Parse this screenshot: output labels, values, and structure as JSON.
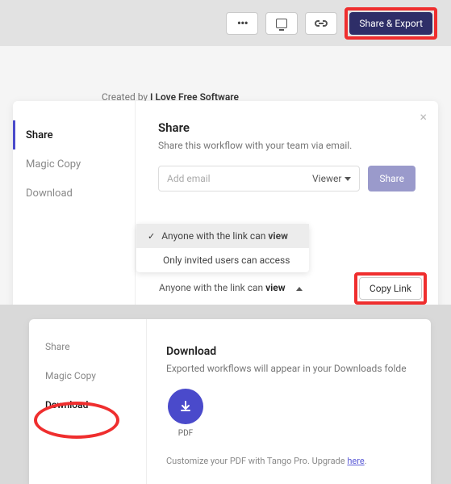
{
  "topbar": {
    "share_export_label": "Share & Export"
  },
  "created_by": {
    "prefix": "Created by ",
    "author": "I Love Free Software"
  },
  "share_panel": {
    "sidebar": [
      {
        "label": "Share",
        "active": true
      },
      {
        "label": "Magic Copy",
        "active": false
      },
      {
        "label": "Download",
        "active": false
      }
    ],
    "title": "Share",
    "description": "Share this workflow with your team via email.",
    "email_placeholder": "Add email",
    "role_label": "Viewer",
    "share_button_label": "Share",
    "access_dropdown": {
      "current_prefix": "Anyone with the link can ",
      "current_bold": "view",
      "options": [
        {
          "prefix": "Anyone with the link can ",
          "bold": "view",
          "selected": true
        },
        {
          "label": "Only invited users can access",
          "selected": false
        }
      ]
    },
    "copy_link_label": "Copy Link"
  },
  "download_panel": {
    "sidebar": [
      {
        "label": "Share",
        "active": false
      },
      {
        "label": "Magic Copy",
        "active": false
      },
      {
        "label": "Download",
        "active": true
      }
    ],
    "title": "Download",
    "description": "Exported workflows will appear in your Downloads folde",
    "pdf_label": "PDF",
    "customize_text": "Customize your PDF with Tango Pro. Upgrade ",
    "customize_link": "here"
  },
  "icons": {
    "more": "more-icon",
    "present": "present-icon",
    "link": "link-icon",
    "close": "close-icon",
    "chevron_down": "chevron-down-icon",
    "chevron_up": "chevron-up-icon",
    "check": "check-icon",
    "download": "download-icon"
  }
}
